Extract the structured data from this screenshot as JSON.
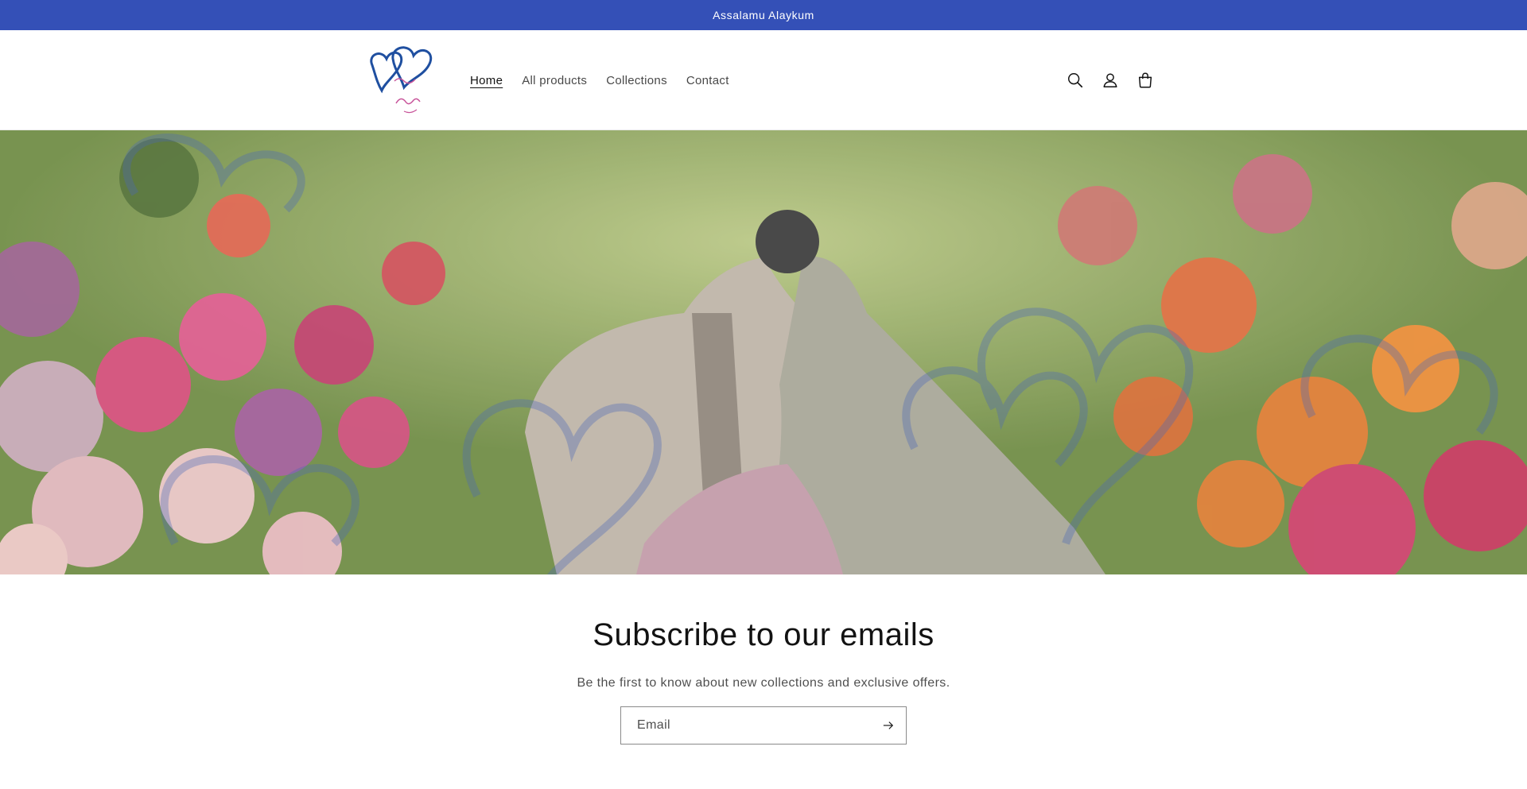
{
  "announcement": {
    "text": "Assalamu Alaykum"
  },
  "header": {
    "logo": {
      "name": "logo-icon",
      "brand_color": "#1f4fa0",
      "script_color": "#c8549a"
    },
    "nav": [
      {
        "label": "Home",
        "active": true
      },
      {
        "label": "All products",
        "active": false
      },
      {
        "label": "Collections",
        "active": false
      },
      {
        "label": "Contact",
        "active": false
      }
    ],
    "icons": [
      "search-icon",
      "account-icon",
      "cart-icon"
    ]
  },
  "hero": {
    "image": "couple-in-flower-garden-banner"
  },
  "newsletter": {
    "title": "Subscribe to our emails",
    "text": "Be the first to know about new collections and exclusive offers.",
    "email_placeholder": "Email",
    "submit_icon": "arrow-right-icon"
  },
  "colors": {
    "announcement_bg": "#3450b7",
    "accent": "#3450b7"
  }
}
